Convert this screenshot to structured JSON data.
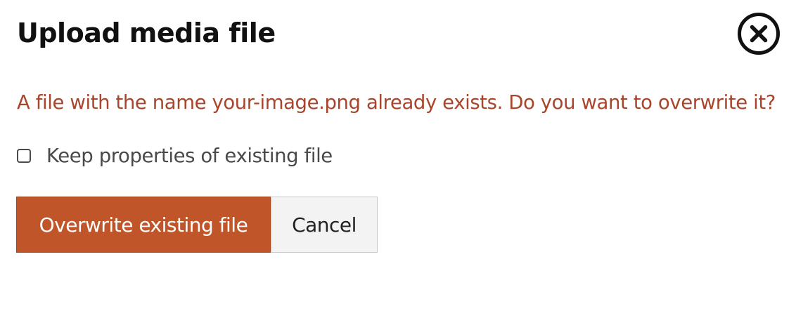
{
  "dialog": {
    "title": "Upload media file",
    "close_icon": "close-circle-icon",
    "message": "A file with the name your-image.png already exists. Do you want to overwrite it?",
    "keep_properties": {
      "label": "Keep properties of existing file",
      "checked": false
    },
    "buttons": {
      "overwrite_label": "Overwrite existing file",
      "cancel_label": "Cancel"
    }
  },
  "colors": {
    "message_text": "#a8452b",
    "primary_button": "#bf5529",
    "secondary_button": "#f3f3f3"
  }
}
